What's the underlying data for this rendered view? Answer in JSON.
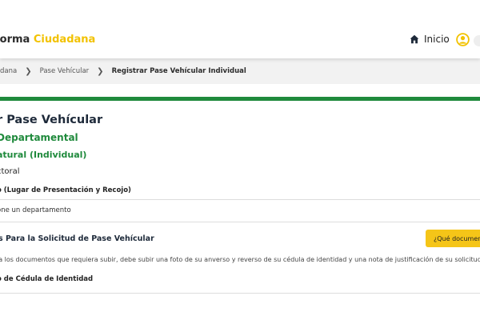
{
  "header": {
    "brand_text": "forma",
    "brand_accent": "Ciudadana",
    "home_label": "Inicio",
    "home_icon": "home-icon",
    "user_icon": "user-circle-icon",
    "accent_color": "#f2c200"
  },
  "breadcrumb": {
    "items": [
      {
        "label": "dana"
      },
      {
        "label": "Pase Vehícular"
      },
      {
        "label": "Registrar Pase Vehícular Individual"
      }
    ]
  },
  "form": {
    "title": "r Pase Vehícular",
    "subtitle_department": "Departamental",
    "subtitle_person_type": "atural (Individual)",
    "field_label_1": "ctoral",
    "field_label_2": "o (Lugar de Presentación y Recojo)",
    "select_placeholder": "one un departamento",
    "requirements_title": "s Para la Solicitud de Pase Vehícular",
    "docs_button_label": "¿Qué documentos",
    "notice": "la los documentos que requiera subir, debe subir una foto de su anverso y reverso de su cédula de identidad y una nota de justificación de su solicitud",
    "doc_type_label": "o de Cédula de Identidad",
    "green_color": "#1f8a3c"
  }
}
